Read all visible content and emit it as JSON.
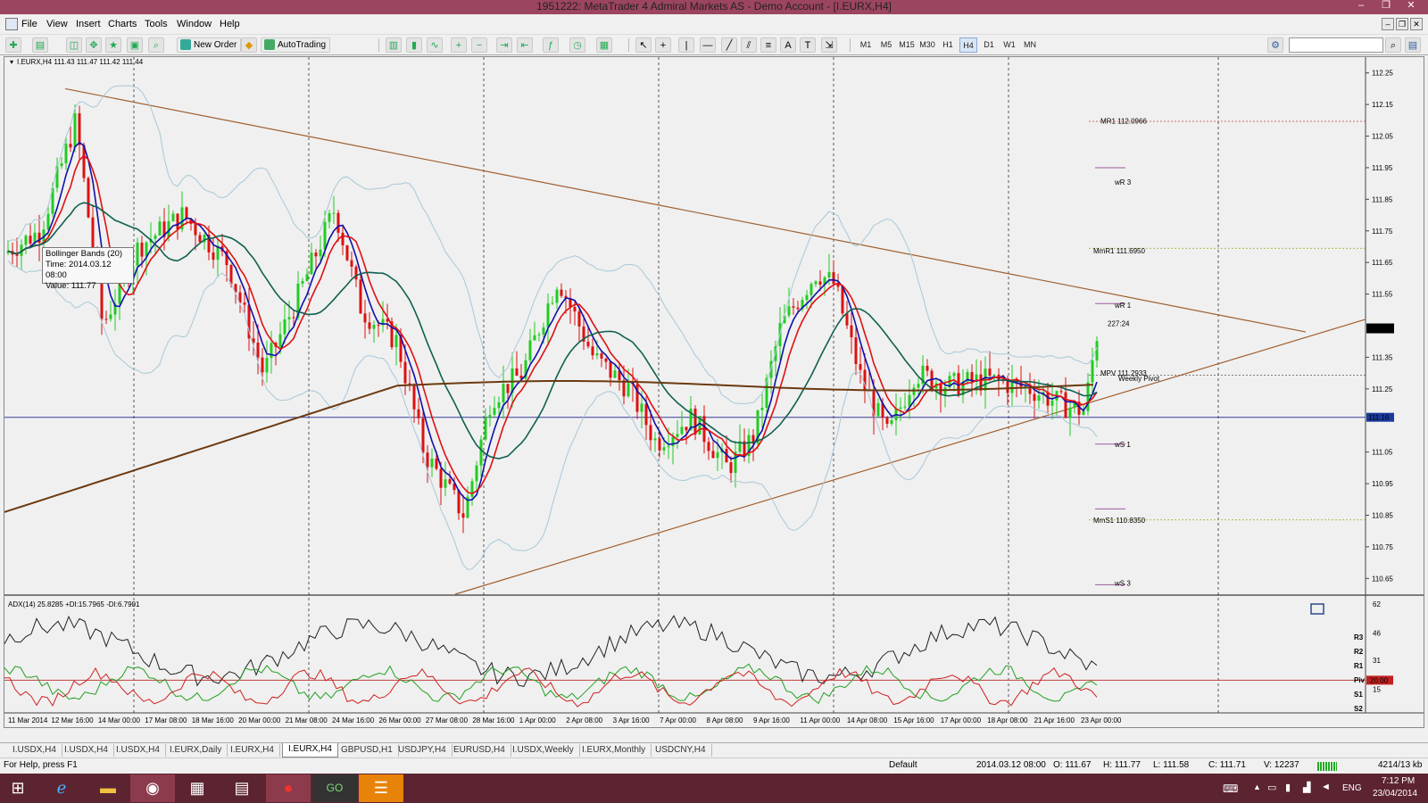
{
  "window": {
    "title": "1951222: MetaTrader 4 Admiral Markets AS - Demo Account - [I.EURX,H4]",
    "controls": [
      "–",
      "❐",
      "✕"
    ]
  },
  "menu": {
    "items": [
      "File",
      "View",
      "Insert",
      "Charts",
      "Tools",
      "Window",
      "Help"
    ]
  },
  "toolbar": {
    "new_order": "New Order",
    "autotrading": "AutoTrading",
    "timeframes": [
      "M1",
      "M5",
      "M15",
      "M30",
      "H1",
      "H4",
      "D1",
      "W1",
      "MN"
    ],
    "active_timeframe": "H4",
    "drawing_text": "A",
    "drawing_label": "T"
  },
  "chart": {
    "header": "I.EURX,H4  111.43 111.47 111.42 111.44",
    "tooltip": {
      "line1": "Bollinger Bands (20)",
      "line2": "Time: 2014.03.12 08:00",
      "line3": "Value: 111.77"
    },
    "price_ticks": [
      "112.25",
      "112.15",
      "112.05",
      "111.95",
      "111.85",
      "111.75",
      "111.65",
      "111.55",
      "111.44",
      "111.35",
      "111.25",
      "111.16",
      "111.05",
      "110.95",
      "110.85",
      "110.75",
      "110.65"
    ],
    "current_price": "111.44",
    "hline_price": "111.16",
    "levels": [
      {
        "label": "MR1",
        "value": "112.0966"
      },
      {
        "label": "wR 3",
        "value": ""
      },
      {
        "label": "MmR1",
        "value": "111.6950"
      },
      {
        "label": "wR 1",
        "value": ""
      },
      {
        "label": "MPV",
        "value": "111.2933"
      },
      {
        "label": "Weekly Pivot",
        "value": ""
      },
      {
        "label": "wS 1",
        "value": ""
      },
      {
        "label": "MmS1",
        "value": "110.8350"
      },
      {
        "label": "wS 3",
        "value": ""
      }
    ],
    "countdown": "227:24",
    "date_ticks": [
      "11 Mar 2014",
      "12 Mar 16:00",
      "14 Mar 00:00",
      "17 Mar 08:00",
      "18 Mar 16:00",
      "20 Mar 00:00",
      "21 Mar 08:00",
      "24 Mar 16:00",
      "26 Mar 00:00",
      "27 Mar 08:00",
      "28 Mar 16:00",
      "1 Apr 00:00",
      "2 Apr 08:00",
      "3 Apr 16:00",
      "7 Apr 00:00",
      "8 Apr 08:00",
      "9 Apr 16:00",
      "11 Apr 00:00",
      "14 Apr 08:00",
      "15 Apr 16:00",
      "17 Apr 00:00",
      "18 Apr 08:00",
      "21 Apr 16:00",
      "23 Apr 00:00"
    ],
    "colors": {
      "bull": "#22cc22",
      "bear": "#dd1111",
      "ma_fast": "#1010aa",
      "ma_slow": "#e01010",
      "ma_teal": "#106050",
      "ma_long": "#6b3a10",
      "bb": "#a8c8d8",
      "trend": "#a06030"
    }
  },
  "indicator": {
    "header": "ADX(14) 25.8285 +DI:15.7965 -DI:6.7901",
    "ticks": [
      "62",
      "46",
      "31",
      "15"
    ],
    "level_value": "20.00",
    "pivot_labels": [
      "R3",
      "R2",
      "R1",
      "Piv",
      "S1",
      "S2"
    ]
  },
  "tabs": {
    "items": [
      "I.USDX,H4",
      "I.USDX,H4",
      "I.USDX,H4",
      "I.EURX,Daily",
      "I.EURX,H4",
      "I.EURX,H4",
      "GBPUSD,H1",
      "USDJPY,H4",
      "EURUSD,H4",
      "I.USDX,Weekly",
      "I.EURX,Monthly",
      "USDCNY,H4"
    ],
    "active_index": 5
  },
  "status": {
    "help": "For Help, press F1",
    "profile": "Default",
    "time": "2014.03.12 08:00",
    "open": "O: 111.67",
    "high": "H: 111.77",
    "low": "L: 111.58",
    "close": "C: 111.71",
    "volume": "V: 12237",
    "traffic": "4214/13 kb"
  },
  "taskbar": {
    "lang": "ENG",
    "time": "7:12 PM",
    "date": "23/04/2014"
  }
}
